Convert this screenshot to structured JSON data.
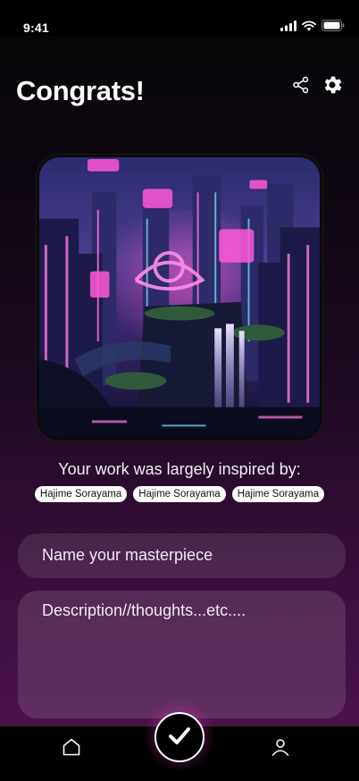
{
  "status_bar": {
    "time": "9:41",
    "icons": [
      "signal-icon",
      "wifi-icon",
      "battery-icon"
    ]
  },
  "header": {
    "title": "Congrats!",
    "share_icon": "share-icon",
    "settings_icon": "gear-icon"
  },
  "artwork": {
    "kind": "generated-image"
  },
  "inspiration": {
    "label": "Your work was largely inspired by:",
    "artists": [
      "Hajime Sorayama",
      "Hajime Sorayama",
      "Hajime Sorayama"
    ]
  },
  "form": {
    "name_placeholder": "Name your masterpiece",
    "description_placeholder": "Description//thoughts...etc...."
  },
  "bottom_nav": {
    "home_icon": "home-icon",
    "confirm_icon": "check-icon",
    "profile_icon": "user-icon"
  },
  "colors": {
    "accent_glow": "#ff3cc8",
    "background_top": "#050505",
    "background_bottom": "#4a1249"
  }
}
